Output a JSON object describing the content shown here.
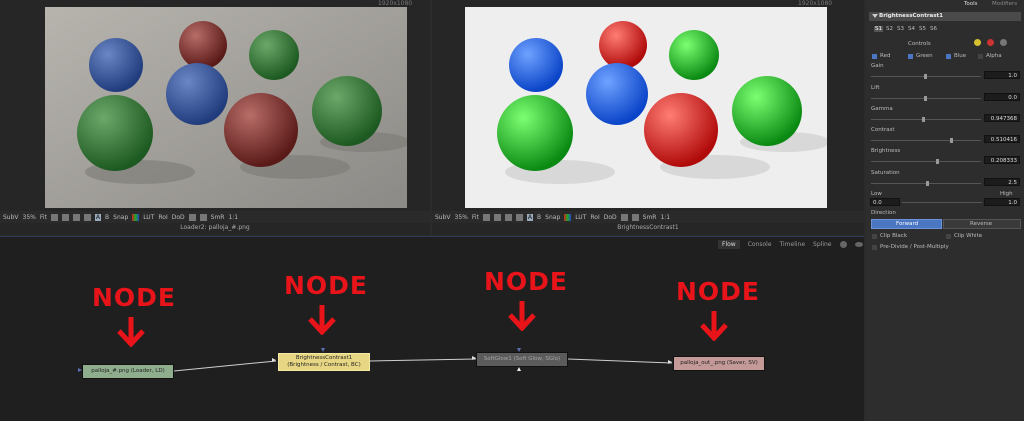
{
  "viewer_left": {
    "resolution": "1920x1080",
    "caption": "Loader2: palloja_#.png",
    "toolbar": [
      "SubV",
      "35%",
      "Fit",
      "A",
      "B",
      "Snap",
      "LUT",
      "RoI",
      "DoD",
      "SmR",
      "1:1"
    ]
  },
  "viewer_right": {
    "resolution": "1920x1080",
    "caption": "BrightnessContrast1",
    "toolbar": [
      "SubV",
      "35%",
      "Fit",
      "A",
      "B",
      "Snap",
      "LUT",
      "RoI",
      "DoD",
      "SmR",
      "1:1"
    ]
  },
  "flow": {
    "tabs": [
      "Flow",
      "Console",
      "Timeline",
      "Spline"
    ],
    "annotation": "NODE",
    "nodes": [
      {
        "label1": "palloja_#.png (Loader, LD)",
        "label2": "",
        "color": "#8fae8d"
      },
      {
        "label1": "BrightnessContrast1",
        "label2": "(Brightness / Contrast, BC)",
        "color": "#e7d784"
      },
      {
        "label1": "SoftGlow1 (Soft Glow, SGlo)",
        "label2": "",
        "color": "#5b5b5b"
      },
      {
        "label1": "palloja_out_.png (Saver, SV)",
        "label2": "",
        "color": "#c39a98"
      }
    ]
  },
  "panel": {
    "tabs": [
      "Tools",
      "Modifiers"
    ],
    "tool_title": "BrightnessContrast1",
    "slots": [
      "S1",
      "S2",
      "S3",
      "S4",
      "S5",
      "S6"
    ],
    "controls_label": "Controls",
    "channels": [
      {
        "label": "Red",
        "checked": true
      },
      {
        "label": "Green",
        "checked": true
      },
      {
        "label": "Blue",
        "checked": true
      },
      {
        "label": "Alpha",
        "checked": false
      }
    ],
    "params": [
      {
        "label": "Gain",
        "value": "1.0"
      },
      {
        "label": "Lift",
        "value": "0.0"
      },
      {
        "label": "Gamma",
        "value": "0.947368"
      },
      {
        "label": "Contrast",
        "value": "0.510416"
      },
      {
        "label": "Brightness",
        "value": "0.208333"
      },
      {
        "label": "Saturation",
        "value": "2.5"
      }
    ],
    "low_label": "Low",
    "high_label": "High",
    "low_value": "0.0",
    "high_value": "1.0",
    "direction_label": "Direction",
    "forward": "Forward",
    "reverse": "Reverse",
    "clip_black": "Clip Black",
    "clip_white": "Clip White",
    "pre_divide": "Pre-Divide / Post-Multiply"
  },
  "colors": {
    "annotation_red": "#e8141a",
    "accent_blue": "#4a76c4"
  }
}
